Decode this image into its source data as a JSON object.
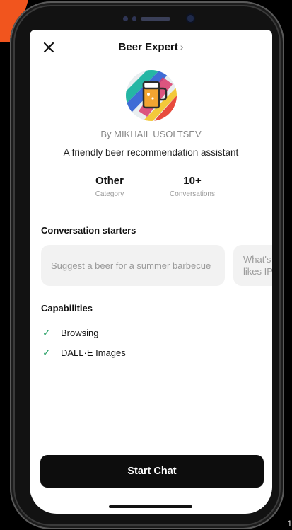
{
  "header": {
    "title": "Beer Expert",
    "chevron": "›"
  },
  "profile": {
    "author": "By MIKHAIL USOLTSEV",
    "description": "A friendly beer recommendation assistant"
  },
  "stats": [
    {
      "value": "Other",
      "label": "Category"
    },
    {
      "value": "10+",
      "label": "Conversations"
    }
  ],
  "starters": {
    "heading": "Conversation starters",
    "items": [
      "Suggest a beer for a summer barbecue",
      "What's a good beer for someone who likes IPAs?"
    ],
    "visible_second": "What's likes IP"
  },
  "capabilities": {
    "heading": "Capabilities",
    "items": [
      "Browsing",
      "DALL·E Images"
    ],
    "check_color": "#2fa36b"
  },
  "cta": {
    "label": "Start Chat"
  },
  "page_number": "1"
}
